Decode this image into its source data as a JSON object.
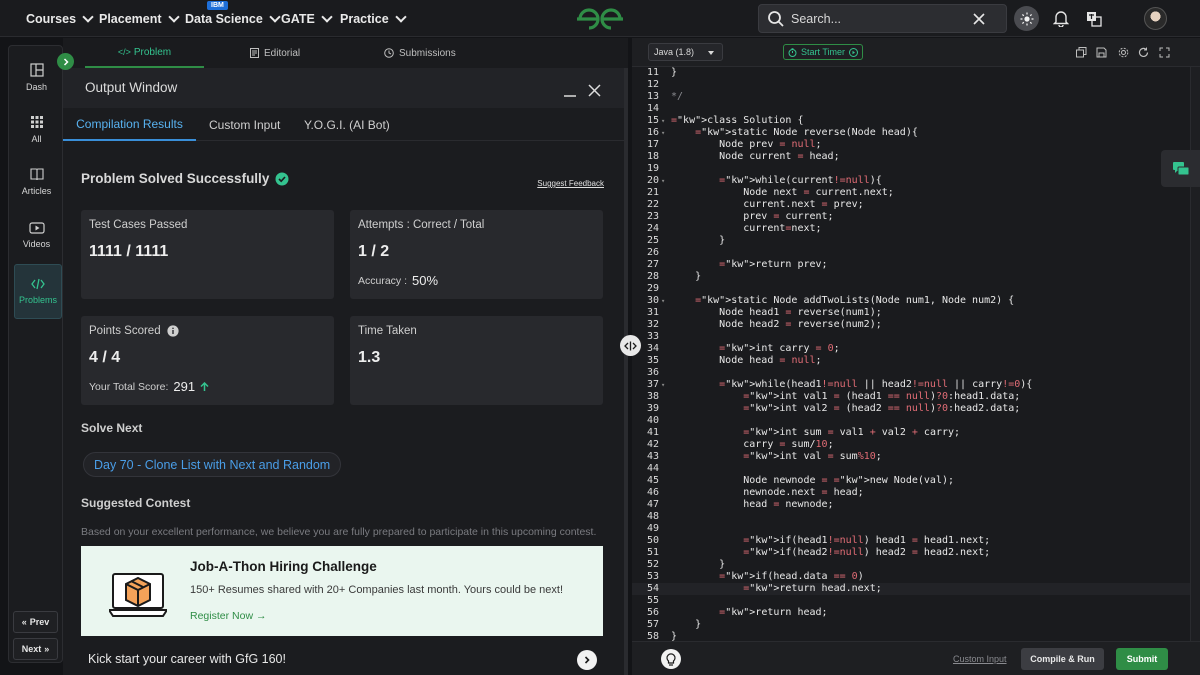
{
  "topnav": {
    "items": [
      {
        "label": "Courses"
      },
      {
        "label": "Placement"
      },
      {
        "label": "Data Science",
        "badge": "IBM"
      },
      {
        "label": "GATE"
      },
      {
        "label": "Practice"
      }
    ],
    "search_placeholder": "Search...",
    "logo_icon": "gfg-logo"
  },
  "sidebar": {
    "items": [
      {
        "label": "Dash",
        "icon": "dashboard-icon"
      },
      {
        "label": "All",
        "icon": "grid-icon"
      },
      {
        "label": "Articles",
        "icon": "book-icon"
      },
      {
        "label": "Videos",
        "icon": "video-icon"
      },
      {
        "label": "Problems",
        "icon": "code-icon"
      }
    ],
    "prev_label": "Prev",
    "next_label": "Next"
  },
  "panel_tabs": {
    "problem": "Problem",
    "editorial": "Editorial",
    "submissions": "Submissions"
  },
  "output_window": {
    "title": "Output Window",
    "tabs": [
      "Compilation Results",
      "Custom Input",
      "Y.O.G.I. (AI Bot)"
    ],
    "status": "Problem Solved Successfully",
    "feedback_link": "Suggest Feedback",
    "test_cases": {
      "label": "Test Cases Passed",
      "value": "1111 / 1111"
    },
    "attempts": {
      "label": "Attempts : Correct / Total",
      "value": "1 / 2",
      "sub_label": "Accuracy :",
      "sub_value": "50%"
    },
    "points": {
      "label": "Points Scored",
      "value": "4 / 4",
      "sub_label": "Your Total Score:",
      "sub_value": "291"
    },
    "time": {
      "label": "Time Taken",
      "value": "1.3"
    },
    "solve_next_title": "Solve Next",
    "solve_next_link": "Day 70 - Clone List with Next and Random",
    "suggested_title": "Suggested Contest",
    "suggested_desc": "Based on your excellent performance, we believe you are fully prepared to participate in this upcoming contest.",
    "banner": {
      "title": "Job-A-Thon Hiring Challenge",
      "desc": "150+ Resumes shared with 20+ Companies last month. Yours could be next!",
      "link": "Register Now →"
    },
    "kick_text": "Kick start your career with GfG 160!"
  },
  "editor": {
    "language": "Java (1.8)",
    "timer_label": "Start Timer",
    "current_line": 54,
    "lines": [
      {
        "n": 11,
        "t": "}"
      },
      {
        "n": 12,
        "t": ""
      },
      {
        "n": 13,
        "t": "*/"
      },
      {
        "n": 14,
        "t": ""
      },
      {
        "n": 15,
        "t": "class Solution {",
        "f": true
      },
      {
        "n": 16,
        "t": "    static Node reverse(Node head){",
        "f": true
      },
      {
        "n": 17,
        "t": "        Node prev = null;"
      },
      {
        "n": 18,
        "t": "        Node current = head;"
      },
      {
        "n": 19,
        "t": ""
      },
      {
        "n": 20,
        "t": "        while(current!=null){",
        "f": true
      },
      {
        "n": 21,
        "t": "            Node next = current.next;"
      },
      {
        "n": 22,
        "t": "            current.next = prev;"
      },
      {
        "n": 23,
        "t": "            prev = current;"
      },
      {
        "n": 24,
        "t": "            current=next;"
      },
      {
        "n": 25,
        "t": "        }"
      },
      {
        "n": 26,
        "t": ""
      },
      {
        "n": 27,
        "t": "        return prev;"
      },
      {
        "n": 28,
        "t": "    }"
      },
      {
        "n": 29,
        "t": ""
      },
      {
        "n": 30,
        "t": "    static Node addTwoLists(Node num1, Node num2) {",
        "f": true
      },
      {
        "n": 31,
        "t": "        Node head1 = reverse(num1);"
      },
      {
        "n": 32,
        "t": "        Node head2 = reverse(num2);"
      },
      {
        "n": 33,
        "t": ""
      },
      {
        "n": 34,
        "t": "        int carry = 0;"
      },
      {
        "n": 35,
        "t": "        Node head = null;"
      },
      {
        "n": 36,
        "t": ""
      },
      {
        "n": 37,
        "t": "        while(head1!=null || head2!=null || carry!=0){",
        "f": true
      },
      {
        "n": 38,
        "t": "            int val1 = (head1 == null)?0:head1.data;"
      },
      {
        "n": 39,
        "t": "            int val2 = (head2 == null)?0:head2.data;"
      },
      {
        "n": 40,
        "t": ""
      },
      {
        "n": 41,
        "t": "            int sum = val1 + val2 + carry;"
      },
      {
        "n": 42,
        "t": "            carry = sum/10;"
      },
      {
        "n": 43,
        "t": "            int val = sum%10;"
      },
      {
        "n": 44,
        "t": ""
      },
      {
        "n": 45,
        "t": "            Node newnode = new Node(val);"
      },
      {
        "n": 46,
        "t": "            newnode.next = head;"
      },
      {
        "n": 47,
        "t": "            head = newnode;"
      },
      {
        "n": 48,
        "t": ""
      },
      {
        "n": 49,
        "t": ""
      },
      {
        "n": 50,
        "t": "            if(head1!=null) head1 = head1.next;"
      },
      {
        "n": 51,
        "t": "            if(head2!=null) head2 = head2.next;"
      },
      {
        "n": 52,
        "t": "        }"
      },
      {
        "n": 53,
        "t": "        if(head.data == 0)"
      },
      {
        "n": 54,
        "t": "            return head.next;"
      },
      {
        "n": 55,
        "t": ""
      },
      {
        "n": 56,
        "t": "        return head;"
      },
      {
        "n": 57,
        "t": "    }"
      },
      {
        "n": 58,
        "t": "}"
      }
    ]
  },
  "bottom": {
    "custom_input": "Custom Input",
    "compile": "Compile & Run",
    "submit": "Submit"
  },
  "colors": {
    "accent_green": "#2f8d46",
    "link_blue": "#4a9ee8",
    "background": "#131417"
  }
}
